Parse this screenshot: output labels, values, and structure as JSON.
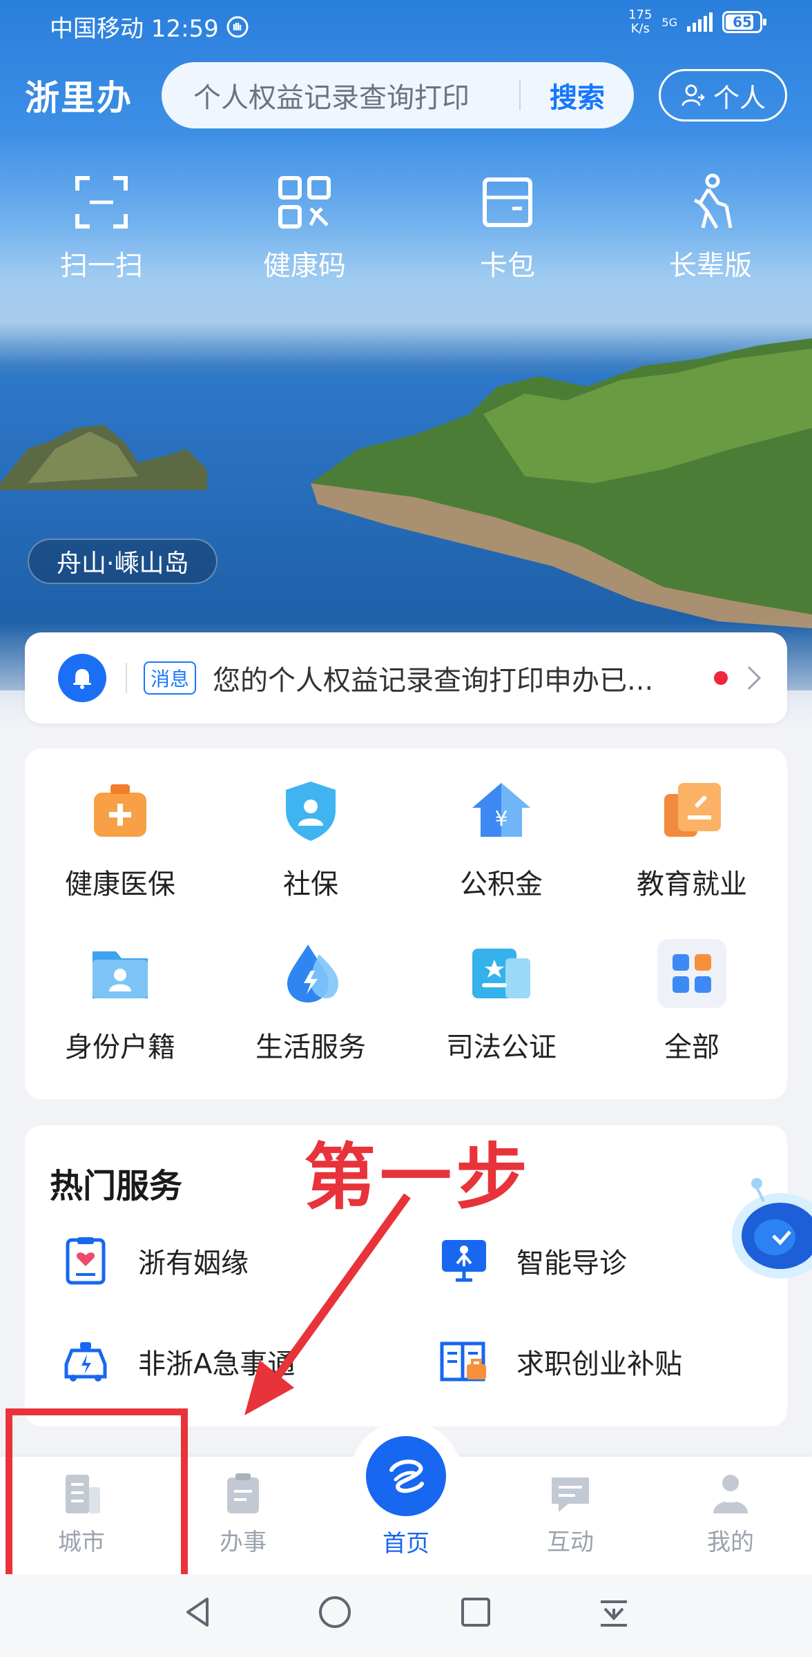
{
  "status_bar": {
    "carrier_time": "中国移动 12:59",
    "net_speed_value": "175",
    "net_speed_unit": "K/s",
    "network": "5G",
    "battery": "65"
  },
  "header": {
    "logo": "浙里办",
    "search_placeholder": "个人权益记录查询打印",
    "search_button": "搜索",
    "personal_button": "个人"
  },
  "quick_actions": [
    {
      "label": "扫一扫",
      "icon": "scan-icon"
    },
    {
      "label": "健康码",
      "icon": "qr-code-icon"
    },
    {
      "label": "卡包",
      "icon": "card-wallet-icon"
    },
    {
      "label": "长辈版",
      "icon": "elder-icon"
    }
  ],
  "location_badge": "舟山·嵊山岛",
  "message": {
    "tag": "消息",
    "text": "您的个人权益记录查询打印申办已..."
  },
  "services": [
    {
      "label": "健康医保",
      "icon": "medical-kit-icon"
    },
    {
      "label": "社保",
      "icon": "social-security-shield-icon"
    },
    {
      "label": "公积金",
      "icon": "housing-fund-icon"
    },
    {
      "label": "教育就业",
      "icon": "education-icon"
    },
    {
      "label": "身份户籍",
      "icon": "id-folder-icon"
    },
    {
      "label": "生活服务",
      "icon": "water-drop-icon"
    },
    {
      "label": "司法公证",
      "icon": "justice-card-icon"
    },
    {
      "label": "全部",
      "icon": "grid-all-icon"
    }
  ],
  "hot_services": {
    "title": "热门服务",
    "items": [
      {
        "label": "浙有姻缘",
        "icon": "marriage-icon"
      },
      {
        "label": "智能导诊",
        "icon": "smart-triage-icon"
      },
      {
        "label": "非浙A急事通",
        "icon": "car-urgent-icon"
      },
      {
        "label": "求职创业补贴",
        "icon": "job-subsidy-icon"
      }
    ]
  },
  "annotation": {
    "step_text": "第一步"
  },
  "tabbar": {
    "tabs": [
      {
        "label": "城市"
      },
      {
        "label": "办事"
      },
      {
        "label": "首页"
      },
      {
        "label": "互动"
      },
      {
        "label": "我的"
      }
    ]
  },
  "colors": {
    "brand_blue": "#1767f0",
    "annotation_red": "#e8333a"
  }
}
